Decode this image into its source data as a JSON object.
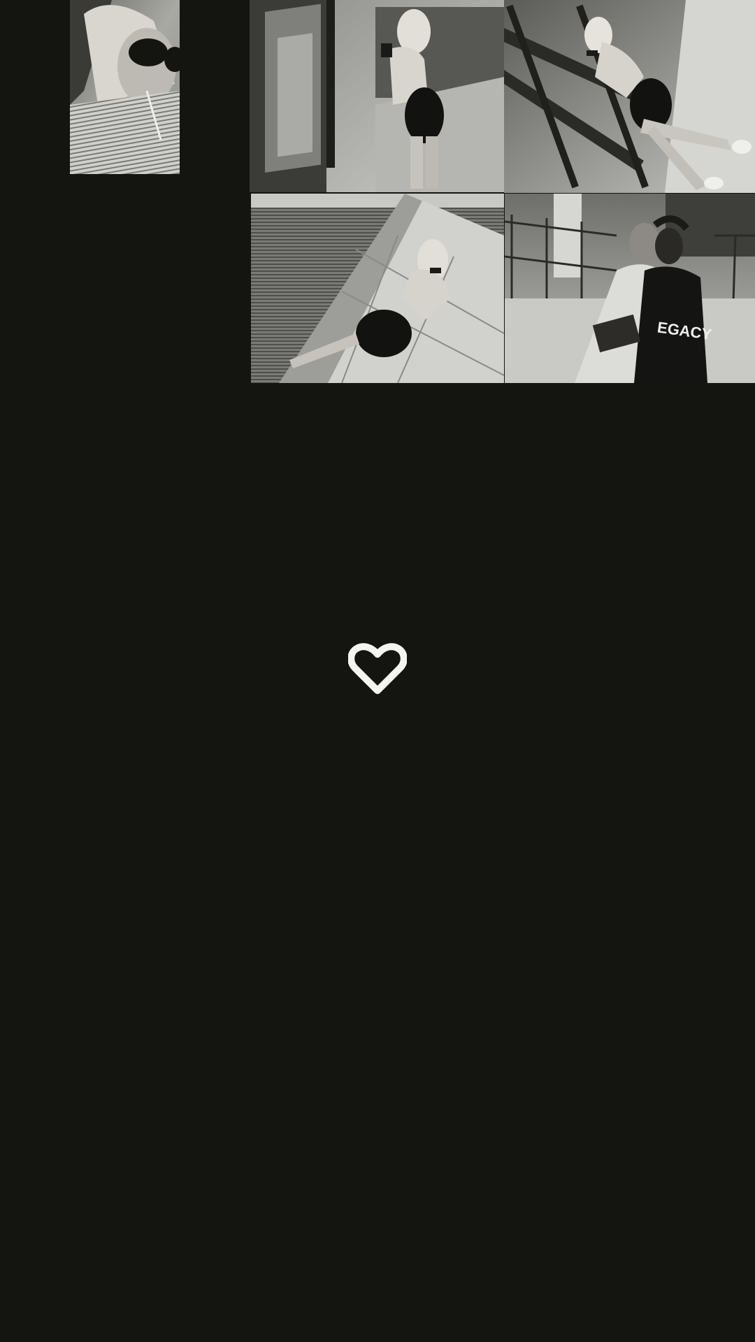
{
  "colors": {
    "background": "#141410",
    "heart_outline": "#f4f4f0"
  },
  "photos": [
    {
      "name": "photo-sunglasses-selfie"
    },
    {
      "name": "photo-gym-mirror-selfie"
    },
    {
      "name": "photo-gym-squat-rack"
    },
    {
      "name": "photo-tiled-mirror-selfie"
    },
    {
      "name": "photo-cheer-friends",
      "shirt_text": "EGACY"
    }
  ],
  "actions": {
    "like_icon": "heart-outline-icon"
  }
}
